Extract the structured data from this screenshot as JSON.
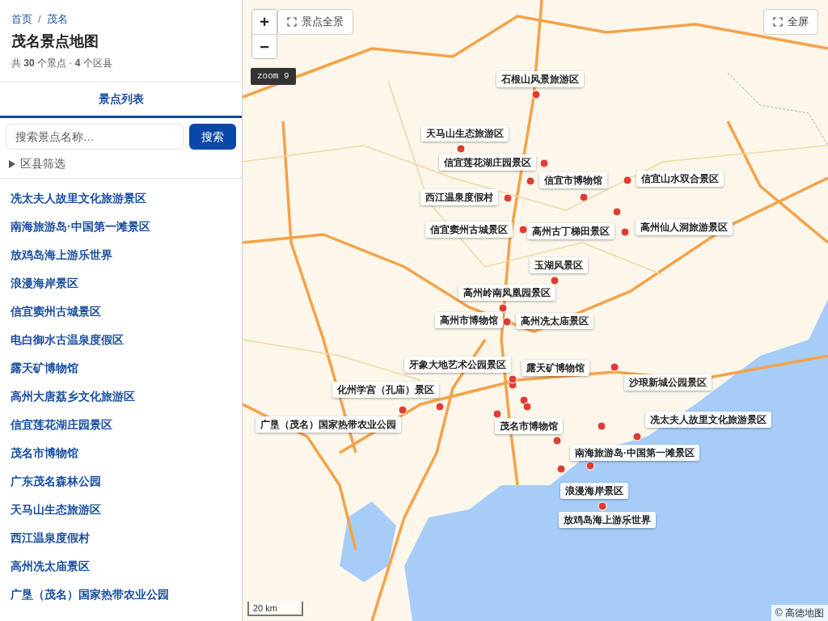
{
  "breadcrumb": [
    {
      "label": "首页"
    },
    {
      "label": "茂名"
    }
  ],
  "breadcrumb_separator": "/",
  "title": "茂名景点地图",
  "summary": "共 **30** 个景点 · **4** 个区县",
  "tabs": [
    {
      "label": "景点列表",
      "selected": true
    }
  ],
  "search": {
    "placeholder": "搜索景点名称…",
    "button": "搜索"
  },
  "filter": {
    "label": "区县筛选",
    "expanded": false
  },
  "spots": [
    {
      "name": "冼太夫人故里文化旅游景区"
    },
    {
      "name": "南海旅游岛·中国第一滩景区"
    },
    {
      "name": "放鸡岛海上游乐世界"
    },
    {
      "name": "浪漫海岸景区"
    },
    {
      "name": "信宜窦州古城景区"
    },
    {
      "name": "电白御水古温泉度假区"
    },
    {
      "name": "露天矿博物馆"
    },
    {
      "name": "高州大唐荔乡文化旅游区"
    },
    {
      "name": "信宜莲花湖庄园景区"
    },
    {
      "name": "茂名市博物馆"
    },
    {
      "name": "广东茂名森林公园"
    },
    {
      "name": "天马山生态旅游区"
    },
    {
      "name": "西江温泉度假村"
    },
    {
      "name": "高州冼太庙景区"
    },
    {
      "name": "广垦（茂名）国家热带农业公园"
    }
  ],
  "map": {
    "zoom_in": "+",
    "zoom_out": "−",
    "fit_button": "景点全景",
    "fullscreen_button": "全屏",
    "zoom_badge": "zoom 9",
    "scale": "20 km",
    "attribution": "© 高德地图",
    "markers": [
      {
        "label": "石根山风景旅游区"
      },
      {
        "label": "天马山生态旅游区"
      },
      {
        "label": "信宜莲花湖庄园景区"
      },
      {
        "label": "信宜市博物馆"
      },
      {
        "label": "信宜山水双合景区"
      },
      {
        "label": "西江温泉度假村"
      },
      {
        "label": "信宜窦州古城景区"
      },
      {
        "label": "高州古丁梯田景区"
      },
      {
        "label": "高州仙人洞旅游景区"
      },
      {
        "label": "玉湖风景区"
      },
      {
        "label": "高州岭南凤凰园景区"
      },
      {
        "label": "高州市博物馆"
      },
      {
        "label": "高州冼太庙景区"
      },
      {
        "label": "牙象大地艺术公园景区"
      },
      {
        "label": "露天矿博物馆"
      },
      {
        "label": "沙琅新城公园景区"
      },
      {
        "label": "化州学宫（孔庙）景区"
      },
      {
        "label": "广垦（茂名）国家热带农业公园"
      },
      {
        "label": "茂名市博物馆"
      },
      {
        "label": "冼太夫人故里文化旅游景区"
      },
      {
        "label": "南海旅游岛·中国第一滩景区"
      },
      {
        "label": "浪漫海岸景区"
      },
      {
        "label": "放鸡岛海上游乐世界"
      }
    ]
  }
}
